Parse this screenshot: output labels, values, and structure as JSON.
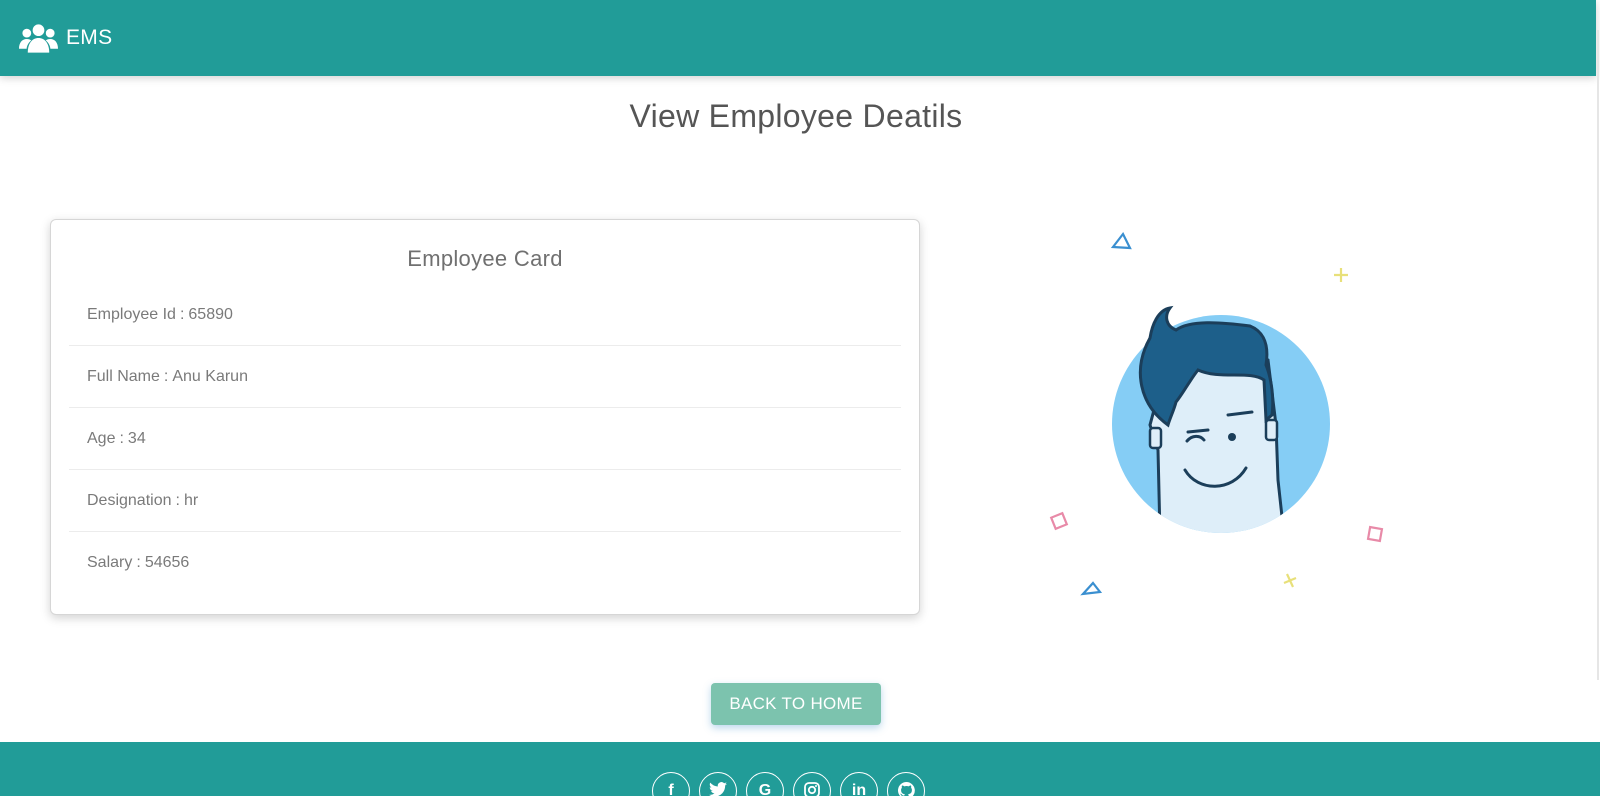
{
  "navbar": {
    "brand": "EMS",
    "brand_icon": "users-icon",
    "color": "#219c98"
  },
  "page": {
    "title": "View Employee Deatils"
  },
  "card": {
    "title": "Employee Card",
    "rows": [
      {
        "label": "Employee Id",
        "value": "65890"
      },
      {
        "label": "Full Name",
        "value": "Anu Karun"
      },
      {
        "label": "Age",
        "value": "34"
      },
      {
        "label": "Designation",
        "value": "hr"
      },
      {
        "label": "Salary",
        "value": "54656"
      }
    ]
  },
  "illustration": {
    "icon": "winking-man-avatar-illustration"
  },
  "actions": {
    "back_label": "BACK TO HOME",
    "back_color": "#7cc3ae"
  },
  "footer": {
    "social": [
      {
        "name": "facebook-icon",
        "glyph": "f"
      },
      {
        "name": "twitter-icon",
        "glyph": ""
      },
      {
        "name": "google-icon",
        "glyph": "G"
      },
      {
        "name": "instagram-icon",
        "glyph": ""
      },
      {
        "name": "linkedin-icon",
        "glyph": "in"
      },
      {
        "name": "github-icon",
        "glyph": ""
      }
    ]
  }
}
